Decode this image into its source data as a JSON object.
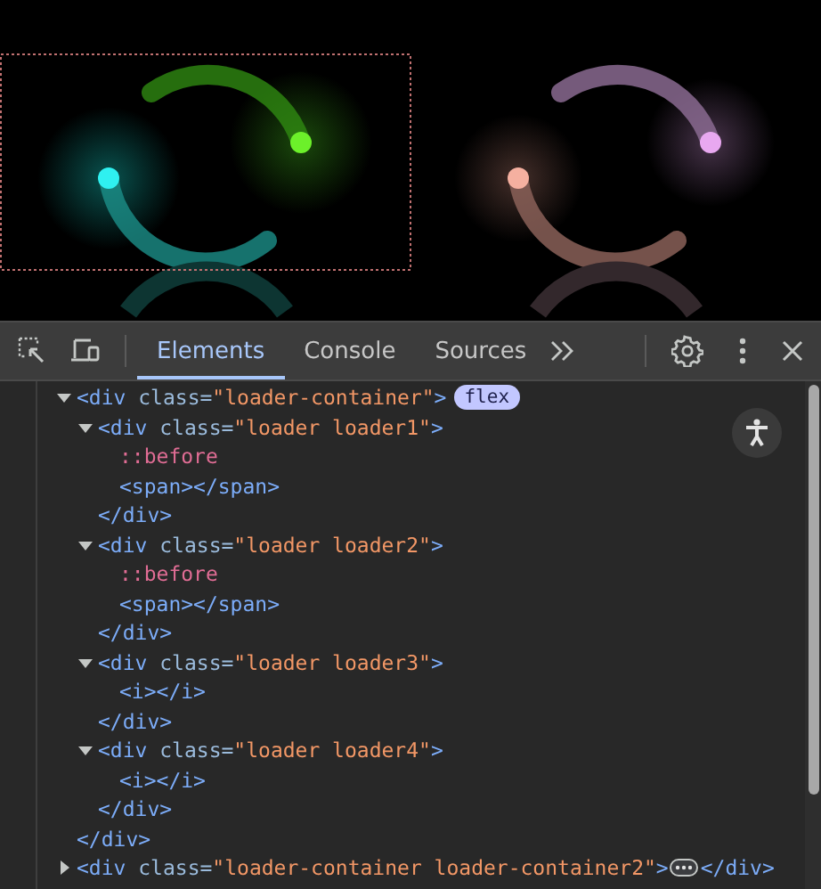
{
  "toolbar": {
    "tabs": [
      {
        "label": "Elements",
        "selected": true
      },
      {
        "label": "Console",
        "selected": false
      },
      {
        "label": "Sources",
        "selected": false
      }
    ]
  },
  "dom_tree": [
    {
      "kind": "element",
      "expanded": true,
      "open": {
        "tag": "<div ",
        "attr": "class=",
        "value": "\"loader-container\"",
        "end": ">"
      },
      "badge": "flex",
      "close": "</div>",
      "children": [
        {
          "kind": "element",
          "expanded": true,
          "open": {
            "tag": "<div ",
            "attr": "class=",
            "value": "\"loader loader1\"",
            "end": ">"
          },
          "close": "</div>",
          "children": [
            {
              "kind": "pseudo",
              "text": "::before"
            },
            {
              "kind": "leaf",
              "open": {
                "tag": "<span></span>"
              }
            }
          ]
        },
        {
          "kind": "element",
          "expanded": true,
          "open": {
            "tag": "<div ",
            "attr": "class=",
            "value": "\"loader loader2\"",
            "end": ">"
          },
          "close": "</div>",
          "children": [
            {
              "kind": "pseudo",
              "text": "::before"
            },
            {
              "kind": "leaf",
              "open": {
                "tag": "<span></span>"
              }
            }
          ]
        },
        {
          "kind": "element",
          "expanded": true,
          "open": {
            "tag": "<div ",
            "attr": "class=",
            "value": "\"loader loader3\"",
            "end": ">"
          },
          "close": "</div>",
          "children": [
            {
              "kind": "leaf",
              "open": {
                "tag": "<i></i>"
              }
            }
          ]
        },
        {
          "kind": "element",
          "expanded": true,
          "open": {
            "tag": "<div ",
            "attr": "class=",
            "value": "\"loader loader4\"",
            "end": ">"
          },
          "close": "</div>",
          "children": [
            {
              "kind": "leaf",
              "open": {
                "tag": "<i></i>"
              }
            }
          ]
        }
      ]
    },
    {
      "kind": "element",
      "expanded": false,
      "open": {
        "tag": "<div ",
        "attr": "class=",
        "value": "\"loader-container loader-container2\"",
        "end": ">"
      },
      "close": "</div>"
    }
  ]
}
